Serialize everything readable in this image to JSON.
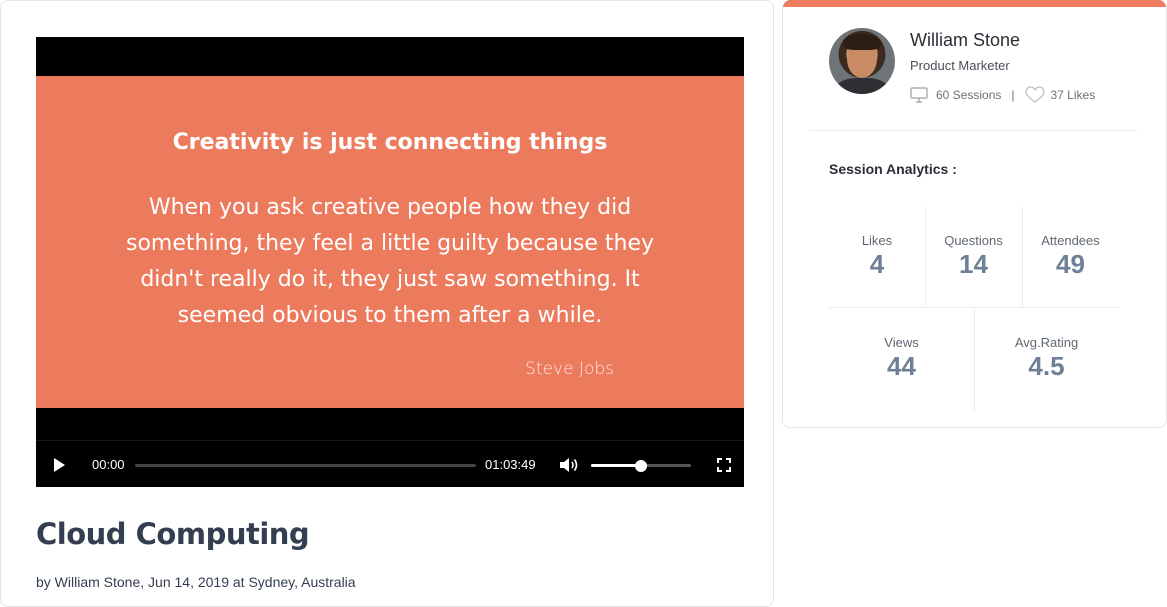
{
  "video": {
    "slide": {
      "title": "Creativity is just connecting things",
      "quote": "When you ask creative people how they did something, they feel a little guilty because they didn't really do it, they just saw something. It seemed obvious to them after a while.",
      "author": "Steve Jobs"
    },
    "player": {
      "current_time": "00:00",
      "total_time": "01:03:49",
      "progress_fraction": 0,
      "volume_fraction": 0.5
    }
  },
  "session": {
    "title": "Cloud Computing",
    "meta": "by William Stone, Jun 14, 2019 at Sydney, Australia"
  },
  "speaker": {
    "name": "William Stone",
    "role": "Product Marketer",
    "sessions": "60 Sessions",
    "separator": "|",
    "likes": "37 Likes"
  },
  "analytics": {
    "title": "Session Analytics :",
    "likes": {
      "label": "Likes",
      "value": "4"
    },
    "questions": {
      "label": "Questions",
      "value": "14"
    },
    "attendees": {
      "label": "Attendees",
      "value": "49"
    },
    "views": {
      "label": "Views",
      "value": "44"
    },
    "rating": {
      "label": "Avg.Rating",
      "value": "4.5"
    }
  },
  "colors": {
    "accent": "#ee7d61",
    "slide_bg": "#ec7b5e",
    "stat_value": "#6f8096",
    "title_text": "#333f50"
  },
  "icons": {
    "play": "play-icon",
    "volume": "volume-icon",
    "fullscreen": "fullscreen-icon",
    "sessions": "monitor-icon",
    "likes": "heart-icon"
  }
}
